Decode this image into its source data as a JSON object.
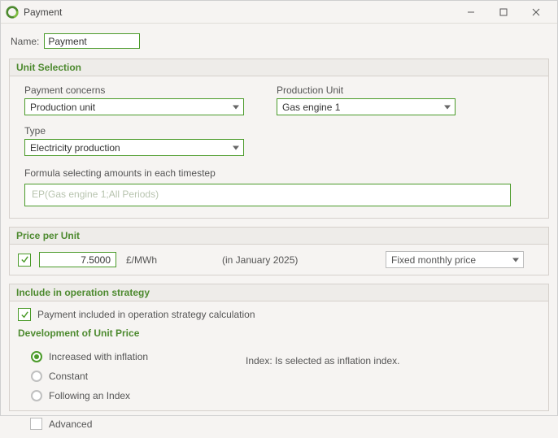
{
  "window": {
    "title": "Payment"
  },
  "name": {
    "label": "Name:",
    "value": "Payment"
  },
  "sections": {
    "unit_selection": {
      "title": "Unit Selection",
      "payment_concerns": {
        "label": "Payment concerns",
        "value": "Production unit"
      },
      "production_unit": {
        "label": "Production Unit",
        "value": "Gas engine 1"
      },
      "type": {
        "label": "Type",
        "value": "Electricity production"
      },
      "formula": {
        "label": "Formula selecting amounts in each timestep",
        "value": "EP(Gas engine 1;All Periods)"
      }
    },
    "price": {
      "title": "Price per Unit",
      "checked": true,
      "value": "7.5000",
      "unit": "£/MWh",
      "in_text": "(in  January 2025)",
      "price_type": "Fixed monthly price"
    },
    "strategy": {
      "title": "Include in operation strategy",
      "checked": true,
      "label": "Payment included in operation strategy calculation"
    },
    "development": {
      "title": "Development of Unit Price",
      "options": [
        "Increased with inflation",
        "Constant",
        "Following an Index"
      ],
      "selected": 0,
      "index_note": "Index: Is selected as inflation index."
    },
    "advanced": {
      "label": "Advanced",
      "checked": false
    }
  }
}
